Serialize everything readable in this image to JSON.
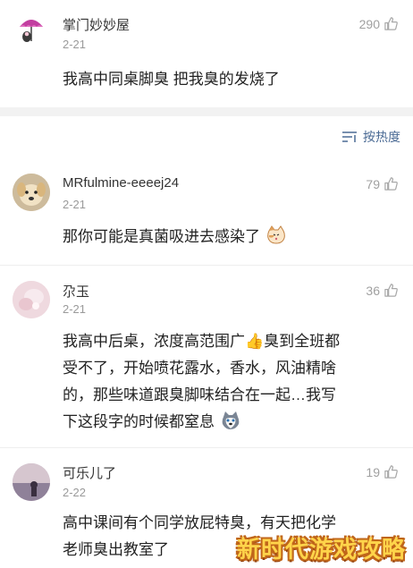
{
  "top_comment": {
    "user": "掌门妙妙屋",
    "date": "2-21",
    "likes": "290",
    "text": "我高中同桌脚臭 把我臭的发烧了"
  },
  "sort": {
    "label": "按热度",
    "icon": "sort-lines-icon"
  },
  "comments": [
    {
      "user": "MRfulmine-eeeej24",
      "date": "2-21",
      "likes": "79",
      "text": "那你可能是真菌吸进去感染了",
      "emoji": "cat-face-emoji"
    },
    {
      "user": "尕玉",
      "date": "2-21",
      "likes": "36",
      "text_lines": [
        "我高中后桌，浓度高范围广👍臭到全班都",
        "受不了，开始喷花露水，香水，风油精啥",
        "的，那些味道跟臭脚味结合在一起…我写",
        "下这段字的时候都窒息"
      ],
      "emoji": "husky-face-emoji"
    },
    {
      "user": "可乐儿了",
      "date": "2-22",
      "likes": "19",
      "text_lines": [
        "高中课间有个同学放屁特臭，有天把化学",
        "老师臭出教室了"
      ]
    }
  ],
  "watermark": "新时代游戏攻略",
  "colors": {
    "link": "#4a6a94",
    "meta": "#9a9a9a",
    "divider": "#f2f2f2"
  }
}
